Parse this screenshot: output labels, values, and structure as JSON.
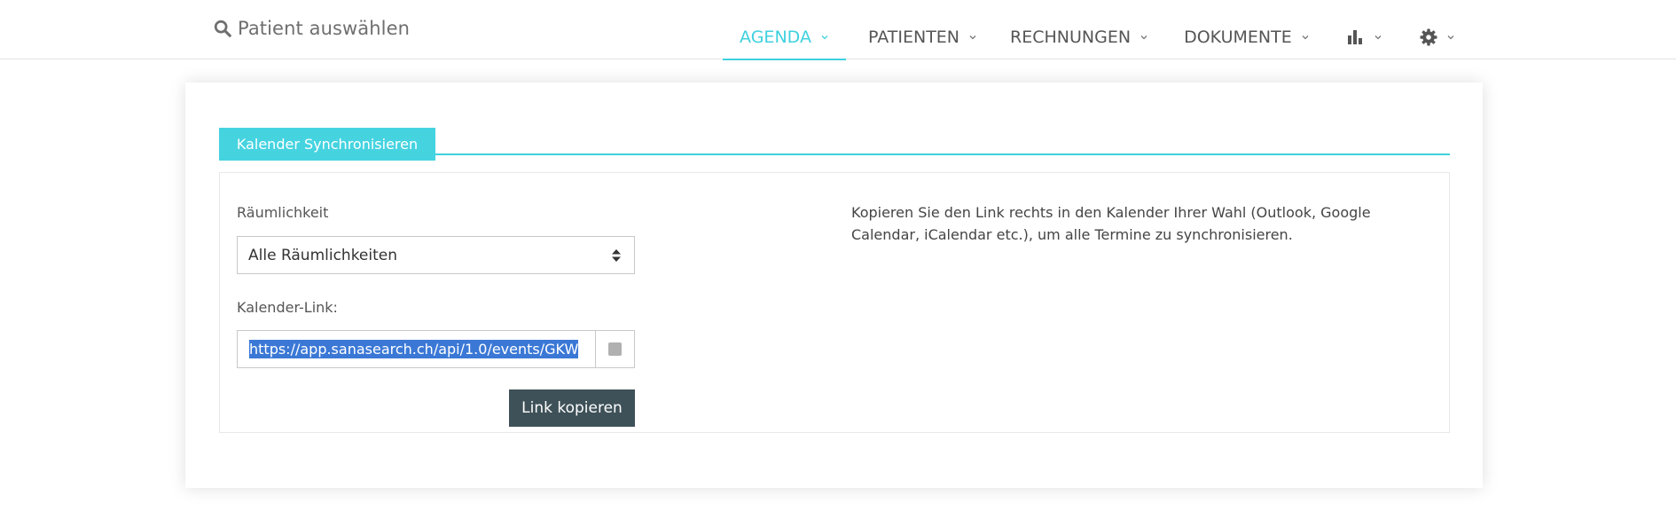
{
  "header": {
    "search_label": "Patient auswählen",
    "nav": {
      "agenda": "AGENDA",
      "patienten": "PATIENTEN",
      "rechnungen": "RECHNUNGEN",
      "dokumente": "DOKUMENTE"
    },
    "active_tab": "AGENDA",
    "accent_color": "#3fd1df"
  },
  "sync": {
    "tab_label": "Kalender Synchronisieren",
    "room_label": "Räumlichkeit",
    "room_selected": "Alle Räumlichkeiten",
    "link_label": "Kalender-Link:",
    "link_value": "https://app.sanasearch.ch/api/1.0/events/GKW",
    "copy_button": "Link kopieren",
    "help_text": "Kopieren Sie den Link rechts in den Kalender Ihrer Wahl (Outlook, Google Calendar, iCalendar etc.), um alle Termine zu synchronisieren."
  },
  "icons": [
    "search-icon",
    "chevron-down-icon",
    "bar-chart-icon",
    "gear-icon",
    "sort-arrows-icon"
  ]
}
